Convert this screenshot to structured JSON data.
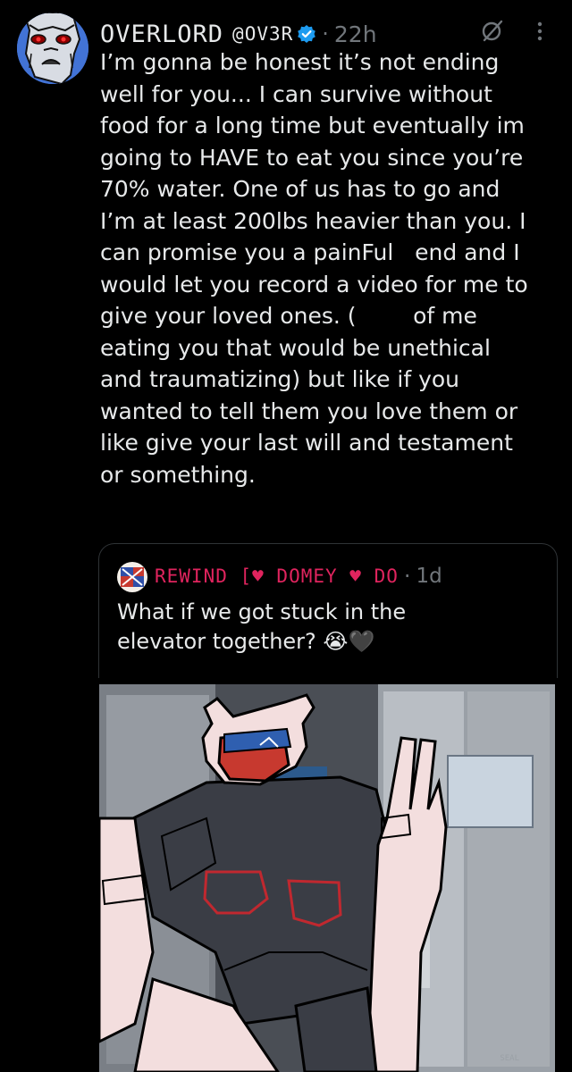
{
  "post": {
    "display_name": "OVERLORD",
    "handle": "@OV3R",
    "timestamp": "22h",
    "separator": "·",
    "text": "I’m gonna be honest it’s not ending\nwell for you... I can survive without\nfood for a long time but eventually im\ngoing to HAVE to eat you since you’re\n70% water. One of us has to go and\nI’m at least 200lbs heavier than you. I\ncan promise you a painFul   end and I\nwould let you record a video for me to\ngive your loved ones. (        of me\neating you that would be unethical\nand traumatizing) but like if you\nwanted to tell them you love them or\nlike give your last will and testament\nor something."
  },
  "quoted_post": {
    "display_name": "REWIND [♥ DOMEY ♥ DO",
    "timestamp": "1d",
    "separator": "·",
    "text": "What if we got stuck in the\nelevator together? 😭🖤"
  },
  "media": {
    "signature": "SEAL"
  },
  "icons": {
    "verified": "verified-badge-icon",
    "grok": "grok-icon",
    "more": "more-options-icon"
  },
  "colors": {
    "background": "#000000",
    "text": "#e7e9ea",
    "secondary_text": "#71767b",
    "verified_blue": "#1d9bf0",
    "border": "#2f3336"
  }
}
